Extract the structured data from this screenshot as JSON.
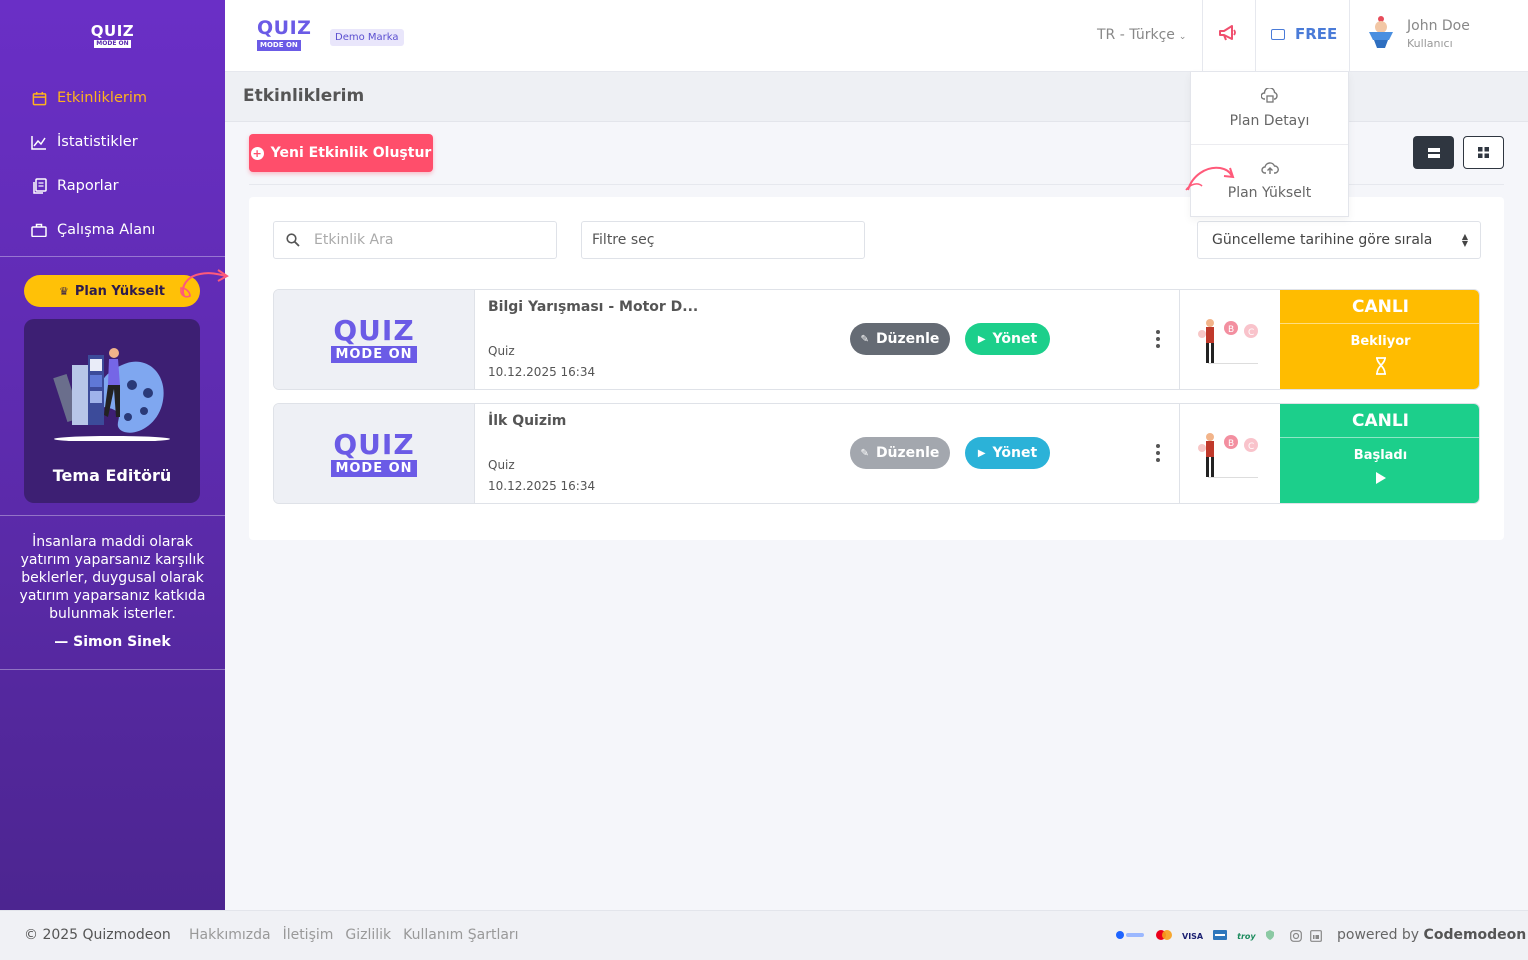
{
  "sidebar": {
    "logo": {
      "q": "QUIZ",
      "m": "MODE ON"
    },
    "items": [
      {
        "label": "Etkinliklerim",
        "icon": "calendar-icon",
        "active": true
      },
      {
        "label": "İstatistikler",
        "icon": "chart-line-icon",
        "active": false
      },
      {
        "label": "Raporlar",
        "icon": "file-copy-icon",
        "active": false
      },
      {
        "label": "Çalışma Alanı",
        "icon": "briefcase-icon",
        "active": false
      }
    ],
    "plan_button": "Plan Yükselt",
    "theme_card_title": "Tema Editörü",
    "quote": {
      "text": "İnsanlara maddi olarak yatırım yaparsanız karşılık beklerler, duygusal olarak yatırım yaparsanız katkıda bulunmak isterler.",
      "author": "— Simon Sinek"
    }
  },
  "topbar": {
    "logo": {
      "q": "QUIZ",
      "m": "MODE ON"
    },
    "brand": "Demo Marka",
    "language": "TR - Türkçe",
    "plan": "FREE",
    "user": {
      "name": "John Doe",
      "role": "Kullanıcı"
    }
  },
  "dropdown": {
    "items": [
      "Plan Detayı",
      "Plan Yükselt"
    ]
  },
  "page": {
    "title": "Etkinliklerim",
    "new_button": "Yeni Etkinlik Oluştur"
  },
  "filters": {
    "search_placeholder": "Etkinlik Ara",
    "filter_placeholder": "Filtre seç",
    "sort": "Güncelleme tarihine göre sırala"
  },
  "events": [
    {
      "title": "Bilgi Yarışması - Motor D...",
      "type": "Quiz",
      "date": "10.12.2025 16:34",
      "edit": "Düzenle",
      "manage": "Yönet",
      "status_head": "CANLI",
      "status": "Bekliyor",
      "status_color": "#ffbc00"
    },
    {
      "title": "İlk Quizim",
      "type": "Quiz",
      "date": "10.12.2025 16:34",
      "edit": "Düzenle",
      "manage": "Yönet",
      "status_head": "CANLI",
      "status": "Başladı",
      "status_color": "#1ccf8b"
    }
  ],
  "footer": {
    "copyright": "© 2025 Quizmodeon",
    "links": [
      "Hakkımızda",
      "İletişim",
      "Gizlilik",
      "Kullanım Şartları"
    ],
    "payments": [
      "VISA",
      "troy"
    ],
    "powered_prefix": "powered by",
    "powered_brand": "Codemodeon"
  },
  "colors": {
    "accent": "#ff4e6b",
    "sidebar": "#6a2fc6",
    "active_nav": "#ffb21d",
    "brand": "#6b5be6"
  }
}
